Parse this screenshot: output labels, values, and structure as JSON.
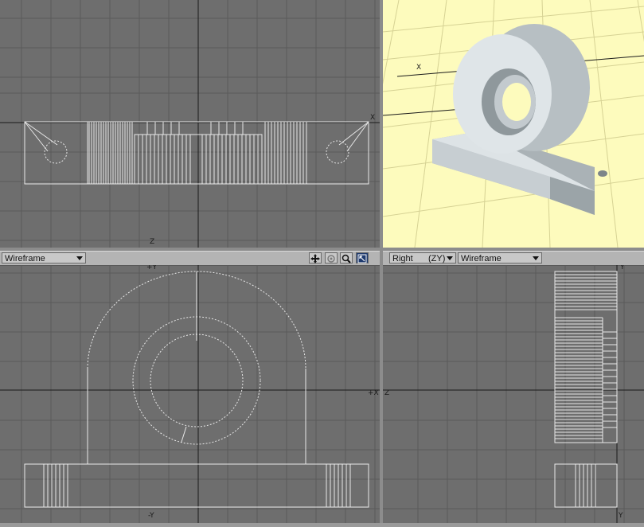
{
  "viewports": {
    "top": {
      "axis_x": "X",
      "axis_z": "Z"
    },
    "perspective": {
      "axis_x": "X"
    },
    "front": {
      "view_mode": "Wireframe",
      "axis_top": "+Y",
      "axis_right": "+X",
      "axis_bottom": "-Y"
    },
    "right": {
      "view_name": "Right",
      "view_axes": "(ZY)",
      "view_mode": "Wireframe",
      "axis_top": "Y",
      "axis_left": "Z",
      "axis_bottom": "Y"
    }
  },
  "toolbar_icons": [
    "move-view-icon",
    "rotate-view-icon",
    "zoom-view-icon",
    "maximize-view-icon"
  ],
  "colors": {
    "viewport_bg": "#6e6e6e",
    "grid": "#5a5a5a",
    "axis": "#1a1a1a",
    "wire": "#e8e8e8",
    "perspective_bg": "#fdfbbd",
    "perspective_grid": "#d8d49a",
    "model_shade": "#cfd6da"
  }
}
